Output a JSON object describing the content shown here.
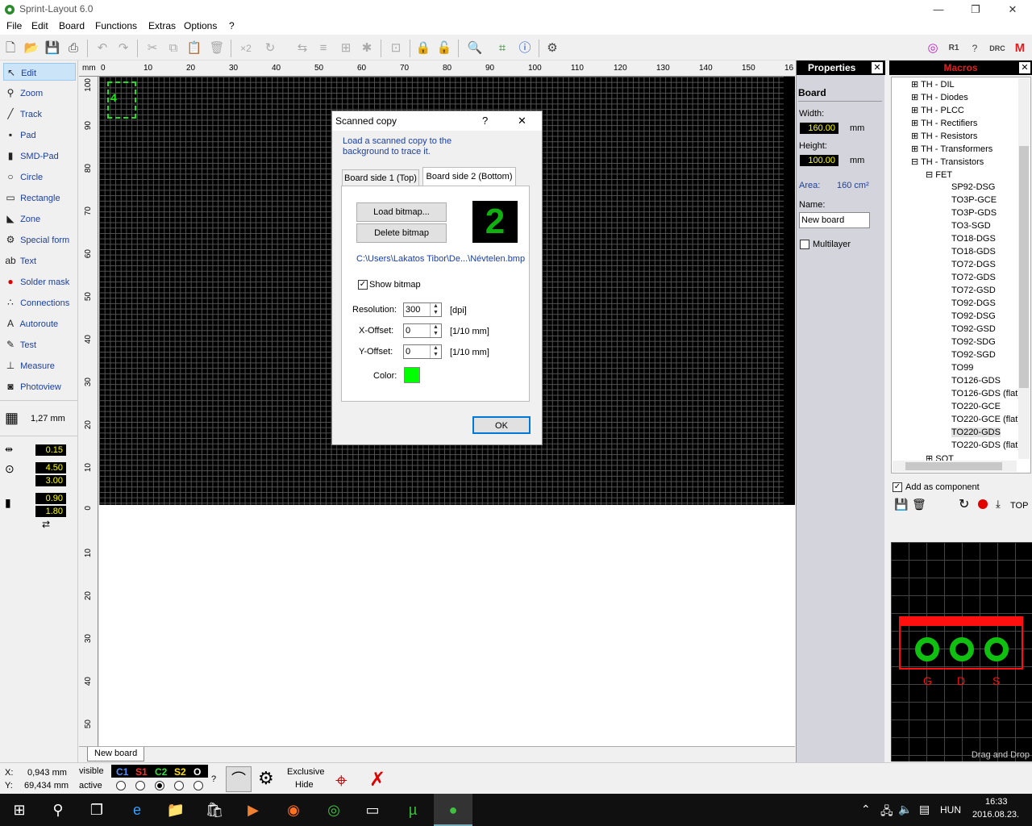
{
  "window": {
    "title": "Sprint-Layout 6.0",
    "minimize": "—",
    "restore": "❐",
    "close": "✕"
  },
  "menu": [
    "File",
    "Edit",
    "Board",
    "Functions",
    "Extras",
    "Options",
    "?"
  ],
  "tools": [
    {
      "label": "Edit",
      "icon": "↖"
    },
    {
      "label": "Zoom",
      "icon": "⚲"
    },
    {
      "label": "Track",
      "icon": "╱"
    },
    {
      "label": "Pad",
      "icon": "▪"
    },
    {
      "label": "SMD-Pad",
      "icon": "▮"
    },
    {
      "label": "Circle",
      "icon": "○"
    },
    {
      "label": "Rectangle",
      "icon": "▭"
    },
    {
      "label": "Zone",
      "icon": "◣"
    },
    {
      "label": "Special form",
      "icon": "⚙"
    },
    {
      "label": "Text",
      "icon": "ab"
    },
    {
      "label": "Solder mask",
      "icon": "●"
    },
    {
      "label": "Connections",
      "icon": "∴"
    },
    {
      "label": "Autoroute",
      "icon": "A"
    },
    {
      "label": "Test",
      "icon": "✎"
    },
    {
      "label": "Measure",
      "icon": "⊥"
    },
    {
      "label": "Photoview",
      "icon": "◙"
    }
  ],
  "grid": {
    "value": "1,27 mm"
  },
  "track_widths": {
    "w1": "0.15",
    "w2a": "4.50",
    "w2b": "3.00",
    "w3a": "0.90",
    "w3b": "1.80"
  },
  "ruler": {
    "unit": "mm",
    "top": [
      "0",
      "10",
      "20",
      "30",
      "40",
      "50",
      "60",
      "70",
      "80",
      "90",
      "100",
      "110",
      "120",
      "130",
      "140",
      "150",
      "16"
    ],
    "left": [
      "100",
      "90",
      "80",
      "70",
      "60",
      "50",
      "40",
      "30",
      "20",
      "10",
      "0",
      "10",
      "20",
      "30",
      "40",
      "50"
    ]
  },
  "sheet_tab": "New board",
  "properties": {
    "title": "Properties",
    "section": "Board",
    "width_label": "Width:",
    "width": "160.00",
    "width_unit": "mm",
    "height_label": "Height:",
    "height": "100.00",
    "height_unit": "mm",
    "area_label": "Area:",
    "area": "160 cm²",
    "name_label": "Name:",
    "name": "New board",
    "multilayer": "Multilayer"
  },
  "macros": {
    "title": "Macros",
    "groups": [
      "TH - DIL",
      "TH - Diodes",
      "TH - PLCC",
      "TH - Rectifiers",
      "TH - Resistors",
      "TH - Transformers",
      "TH - Transistors"
    ],
    "subgroup": "FET",
    "items": [
      "SP92-DSG",
      "TO3P-GCE",
      "TO3P-GDS",
      "TO3-SGD",
      "TO18-DGS",
      "TO18-GDS",
      "TO72-DGS",
      "TO72-GDS",
      "TO72-GSD",
      "TO92-DGS",
      "TO92-DSG",
      "TO92-GSD",
      "TO92-SDG",
      "TO92-SGD",
      "TO99",
      "TO126-GDS",
      "TO126-GDS (flat)",
      "TO220-GCE",
      "TO220-GCE (flat)",
      "TO220-GDS",
      "TO220-GDS (flat)"
    ],
    "next_group": "SOT",
    "add_component": "Add as component",
    "top_label": "TOP",
    "pins": [
      "G",
      "D",
      "S"
    ],
    "drag_drop": "Drag and Drop"
  },
  "status": {
    "x_label": "X:",
    "x": "0,943 mm",
    "y_label": "Y:",
    "y": "69,434 mm",
    "visible": "visible",
    "active": "active",
    "layers": [
      {
        "n": "C1",
        "c": "#4f8fff"
      },
      {
        "n": "S1",
        "c": "#ff3030"
      },
      {
        "n": "C2",
        "c": "#30e030"
      },
      {
        "n": "S2",
        "c": "#ffe000"
      },
      {
        "n": "O",
        "c": "#ffffff"
      }
    ],
    "q": "?",
    "exclusive": "Exclusive",
    "hide": "Hide"
  },
  "dialog": {
    "title": "Scanned copy",
    "help": "?",
    "close": "✕",
    "info": "Load a scanned copy to the background to trace it.",
    "tab1": "Board side 1 (Top)",
    "tab2": "Board side 2 (Bottom)",
    "load": "Load bitmap...",
    "delete": "Delete bitmap",
    "side_number": "2",
    "path": "C:\\Users\\Lakatos Tibor\\De...\\Névtelen.bmp",
    "show_bitmap": "Show bitmap",
    "res_label": "Resolution:",
    "res": "300",
    "res_unit": "[dpi]",
    "xoff_label": "X-Offset:",
    "xoff": "0",
    "xoff_unit": "[1/10 mm]",
    "yoff_label": "Y-Offset:",
    "yoff": "0",
    "yoff_unit": "[1/10 mm]",
    "color_label": "Color:",
    "color": "#00ff00",
    "ok": "OK"
  },
  "taskbar": {
    "lang": "HUN",
    "time": "16:33",
    "date": "2016.08.23."
  }
}
